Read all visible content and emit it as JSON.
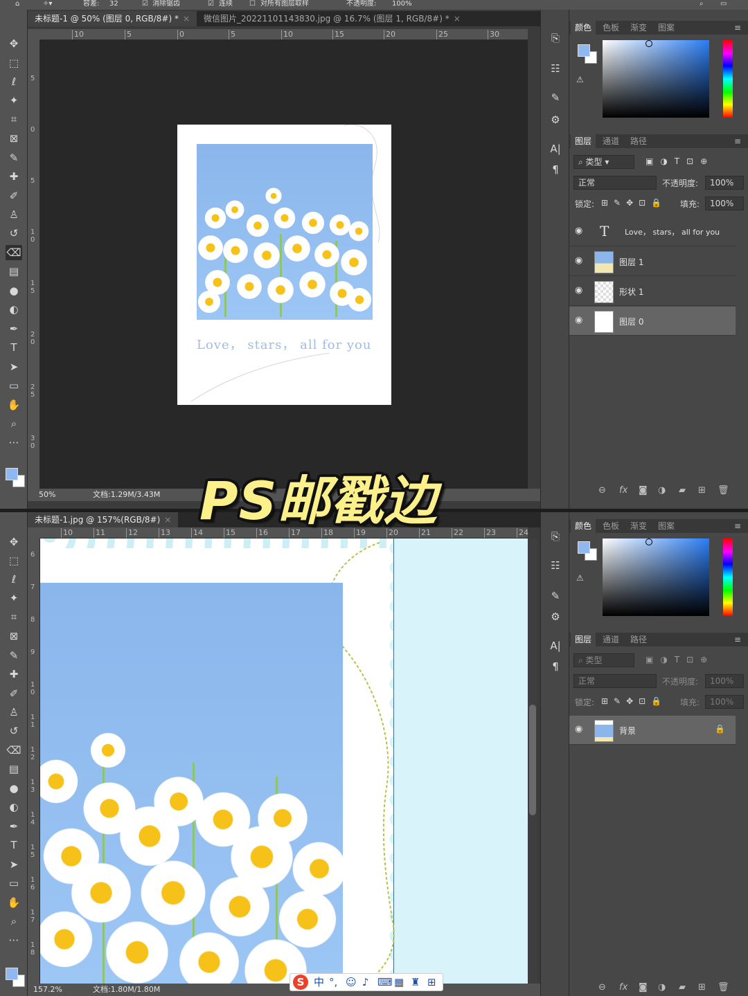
{
  "overlay": {
    "title": "PS邮戳边"
  },
  "top": {
    "options": {
      "hardness_label": "容差:",
      "hardness_value": "32",
      "antialias": "消除锯齿",
      "contiguous": "连续",
      "sample_all": "对所有图层取样",
      "opacity_label": "不透明度:",
      "opacity_value": "100%"
    },
    "tabs": [
      {
        "label": "未标题-1 @ 50% (图层 0, RGB/8#) *",
        "close": "×"
      },
      {
        "label": "微信图片_20221101143830.jpg @ 16.7% (图层 1, RGB/8#) *",
        "close": "×"
      }
    ],
    "ruler_ticks": [
      "10",
      "5",
      "0",
      "5",
      "10",
      "15",
      "20",
      "25",
      "30"
    ],
    "vruler_ticks": [
      "5",
      "0",
      "5",
      "1 0",
      "1 5",
      "2 0",
      "2 5",
      "3 0"
    ],
    "card_text": "Love， stars，  all for you",
    "status": {
      "zoom": "50%",
      "doc": "文档:1.29M/3.43M"
    },
    "color_tabs": [
      "颜色",
      "色板",
      "渐变",
      "图案"
    ],
    "layer_tabs": [
      "图层",
      "通道",
      "路径"
    ],
    "filter": "类型",
    "blend_mode": "正常",
    "opacity_label": "不透明度:",
    "opacity_value": "100%",
    "lock_label": "锁定:",
    "fill_label": "填充:",
    "fill_value": "100%",
    "layers": [
      {
        "name": "Love， stars， all for you",
        "kind": "text"
      },
      {
        "name": "图层 1",
        "kind": "image"
      },
      {
        "name": "形状 1",
        "kind": "shape"
      },
      {
        "name": "图层 0",
        "kind": "white"
      }
    ]
  },
  "bottom": {
    "tabs": [
      {
        "label": "未标题-1.jpg @ 157%(RGB/8#)",
        "close": "×"
      }
    ],
    "ruler_ticks": [
      "10",
      "11",
      "12",
      "13",
      "14",
      "15",
      "16",
      "17",
      "18",
      "19",
      "20",
      "21",
      "22",
      "23",
      "24"
    ],
    "vruler_ticks": [
      "6",
      "7",
      "8",
      "9",
      "1 0",
      "1 1",
      "1 2",
      "1 3",
      "1 4",
      "1 5",
      "1 6",
      "1 7",
      "1 8"
    ],
    "status": {
      "zoom": "157.2%",
      "doc": "文档:1.80M/1.80M"
    },
    "color_tabs": [
      "颜色",
      "色板",
      "渐变",
      "图案"
    ],
    "layer_tabs": [
      "图层",
      "通道",
      "路径"
    ],
    "filter": "类型",
    "blend_mode": "正常",
    "opacity_label": "不透明度:",
    "opacity_value": "100%",
    "lock_label": "锁定:",
    "fill_label": "填充:",
    "fill_value": "100%",
    "layers": [
      {
        "name": "背景",
        "kind": "image",
        "locked": true
      }
    ]
  },
  "ime": {
    "logo": "S",
    "lang": "中",
    "punct": "°,"
  }
}
